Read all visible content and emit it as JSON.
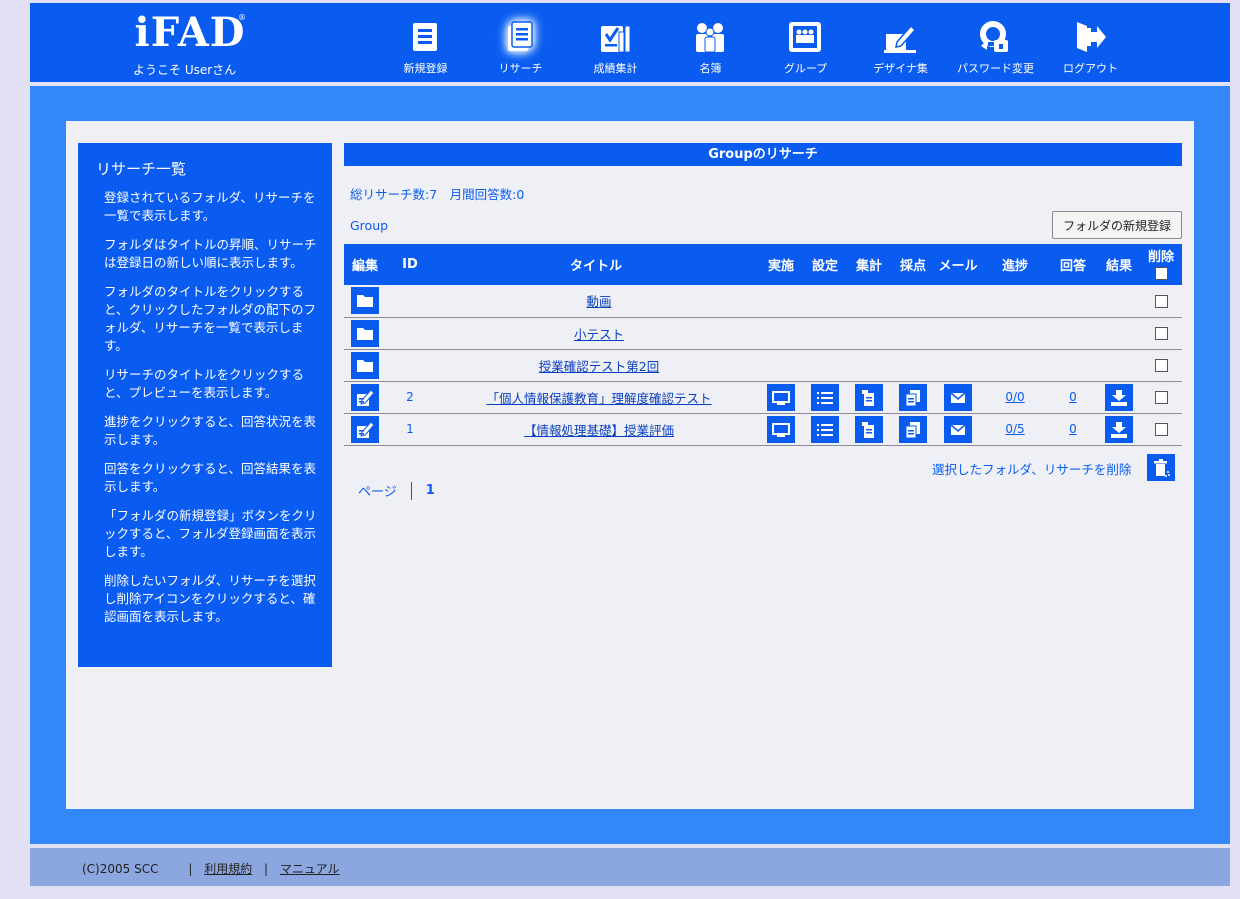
{
  "header": {
    "logo": "iFAD",
    "logo_mark": "®",
    "welcome": "ようこそ Userさん",
    "nav": [
      {
        "label": "新規登録",
        "icon": "new-registration-icon"
      },
      {
        "label": "リサーチ",
        "icon": "research-icon",
        "active": true
      },
      {
        "label": "成績集計",
        "icon": "grade-summary-icon"
      },
      {
        "label": "名簿",
        "icon": "roster-icon"
      },
      {
        "label": "グループ",
        "icon": "group-icon"
      },
      {
        "label": "デザイナ集",
        "icon": "designer-icon"
      },
      {
        "label": "パスワード変更",
        "icon": "password-change-icon"
      },
      {
        "label": "ログアウト",
        "icon": "logout-icon"
      }
    ]
  },
  "sidebar": {
    "title": "リサーチ一覧",
    "paragraphs": [
      "登録されているフォルダ、リサーチを一覧で表示します。",
      "フォルダはタイトルの昇順、リサーチは登録日の新しい順に表示します。",
      "フォルダのタイトルをクリックすると、クリックしたフォルダの配下のフォルダ、リサーチを一覧で表示します。",
      "リサーチのタイトルをクリックすると、プレビューを表示します。",
      "進捗をクリックすると、回答状況を表示します。",
      "回答をクリックすると、回答結果を表示します。",
      "「フォルダの新規登録」ボタンをクリックすると、フォルダ登録画面を表示します。",
      "削除したいフォルダ、リサーチを選択し削除アイコンをクリックすると、確認画面を表示します。"
    ]
  },
  "main": {
    "section_title": "Groupのリサーチ",
    "summary": "総リサーチ数:7　月間回答数:0",
    "breadcrumb": "Group",
    "new_folder_button": "フォルダの新規登録",
    "table": {
      "headers": {
        "edit": "編集",
        "id": "ID",
        "title": "タイトル",
        "run": "実施",
        "settings": "設定",
        "aggregate": "集計",
        "score": "採点",
        "mail": "メール",
        "progress": "進捗",
        "answers": "回答",
        "results": "結果",
        "delete": "削除"
      },
      "rows": [
        {
          "type": "folder",
          "id": "",
          "title": "動画"
        },
        {
          "type": "folder",
          "id": "",
          "title": "小テスト"
        },
        {
          "type": "folder",
          "id": "",
          "title": "授業確認テスト第2回"
        },
        {
          "type": "research",
          "id": "2",
          "title": "「個人情報保護教育」理解度確認テスト",
          "progress": "0/0",
          "answers": "0"
        },
        {
          "type": "research",
          "id": "1",
          "title": "【情報処理基礎】授業評価",
          "progress": "0/5",
          "answers": "0"
        }
      ]
    },
    "bulk_delete_label": "選択したフォルダ、リサーチを削除",
    "pager": {
      "label": "ページ",
      "current": "1"
    }
  },
  "footer": {
    "copyright": "(C)2005 SCC",
    "links": [
      "利用規約",
      "マニュアル"
    ]
  },
  "colors": {
    "primary": "#0a5cf0",
    "frame": "#3288f8",
    "panel": "#efeff6",
    "footer": "#8ca6e0",
    "page": "#e2e0f4"
  }
}
